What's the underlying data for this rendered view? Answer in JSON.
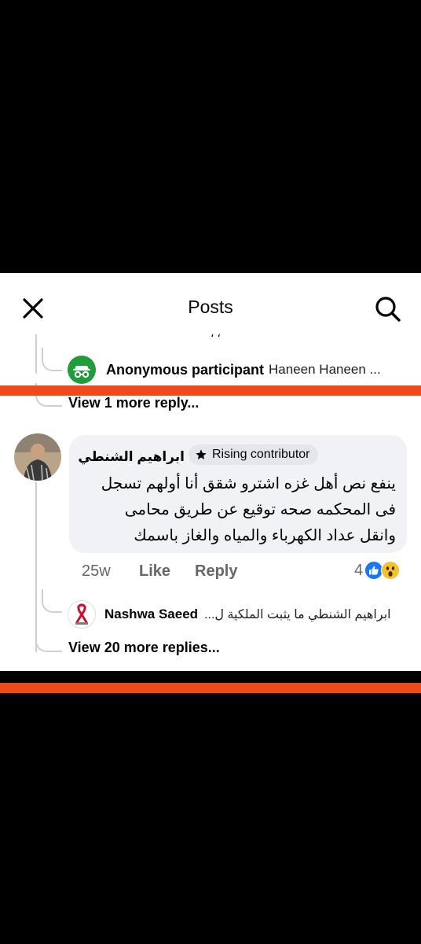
{
  "header": {
    "title": "Posts",
    "close_icon": "close-icon",
    "search_icon": "search-icon"
  },
  "truncated_text": "، ،",
  "thread": {
    "reply_preview_1": {
      "author": "Anonymous participant",
      "text": "Haneen Haneen ..."
    },
    "view_more_1": "View 1 more reply...",
    "comment": {
      "author": "ابراهيم الشنطي",
      "badge": "Rising contributor",
      "lines": [
        "ينفع نص أهل غزه اشترو شقق أنا أولهم تسجل",
        "فى المحكمه صحه توقيع عن طريق محامى",
        "وانقل عداد الكهرباء والمياه والغاز باسمك"
      ],
      "time": "25w",
      "like": "Like",
      "reply": "Reply",
      "reaction_count": "4"
    },
    "reply_preview_2": {
      "author": "Nashwa Saeed",
      "text": "ابراهيم الشنطي ما يثبت الملكية ل..."
    },
    "view_more_2": "View 20 more replies..."
  },
  "colors": {
    "overlay_red": "#f04a1b",
    "like_blue": "#1877f2",
    "anon_green": "#1e9e3a"
  }
}
